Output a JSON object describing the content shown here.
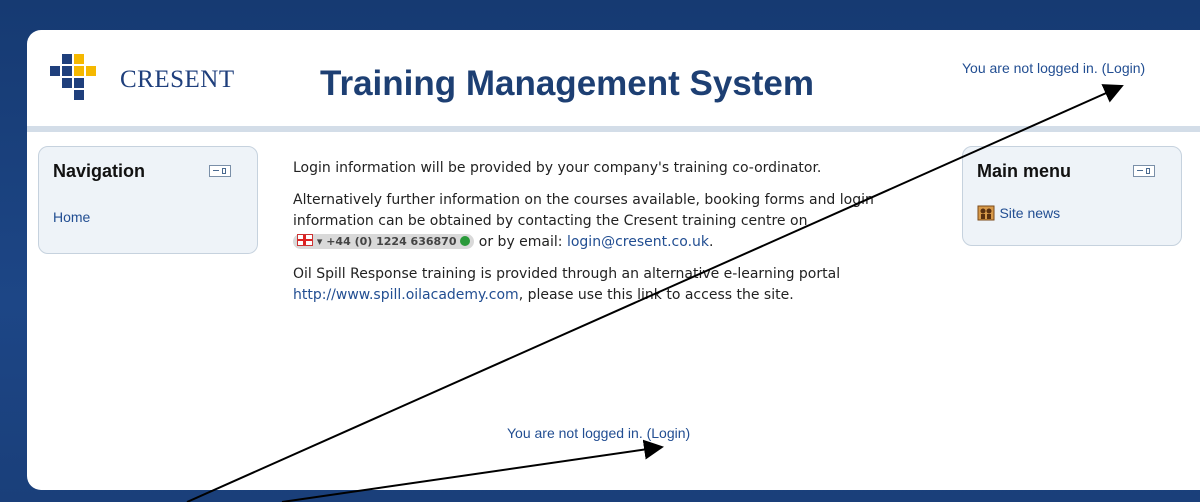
{
  "header": {
    "logo_text": "CRESENT",
    "title": "Training Management System",
    "login_status": "You are not logged in.",
    "login_link": "(Login)"
  },
  "nav_block": {
    "title": "Navigation",
    "items": [
      {
        "label": "Home"
      }
    ]
  },
  "menu_block": {
    "title": "Main menu",
    "items": [
      {
        "label": "Site news"
      }
    ]
  },
  "content": {
    "p1": "Login information will be provided by your company's training co-ordinator.",
    "p2_a": "Alternatively further information on the courses available, booking forms and login information can be obtained by contacting the Cresent training centre on",
    "phone": "+44 (0) 1224 636870",
    "p2_b": "or by email:",
    "email": "login@cresent.co.uk",
    "p3_a": "Oil Spill Response training is provided through an alternative e-learning portal",
    "portal_url": "http://www.spill.oilacademy.com",
    "p3_b": ", please use this link to access the site."
  },
  "footer": {
    "login_status": "You are not logged in.",
    "login_link": "(Login)"
  },
  "colors": {
    "background": "#1a3f7a",
    "title": "#1d3f73",
    "link": "#224e92",
    "block_bg": "#eef3f8"
  }
}
